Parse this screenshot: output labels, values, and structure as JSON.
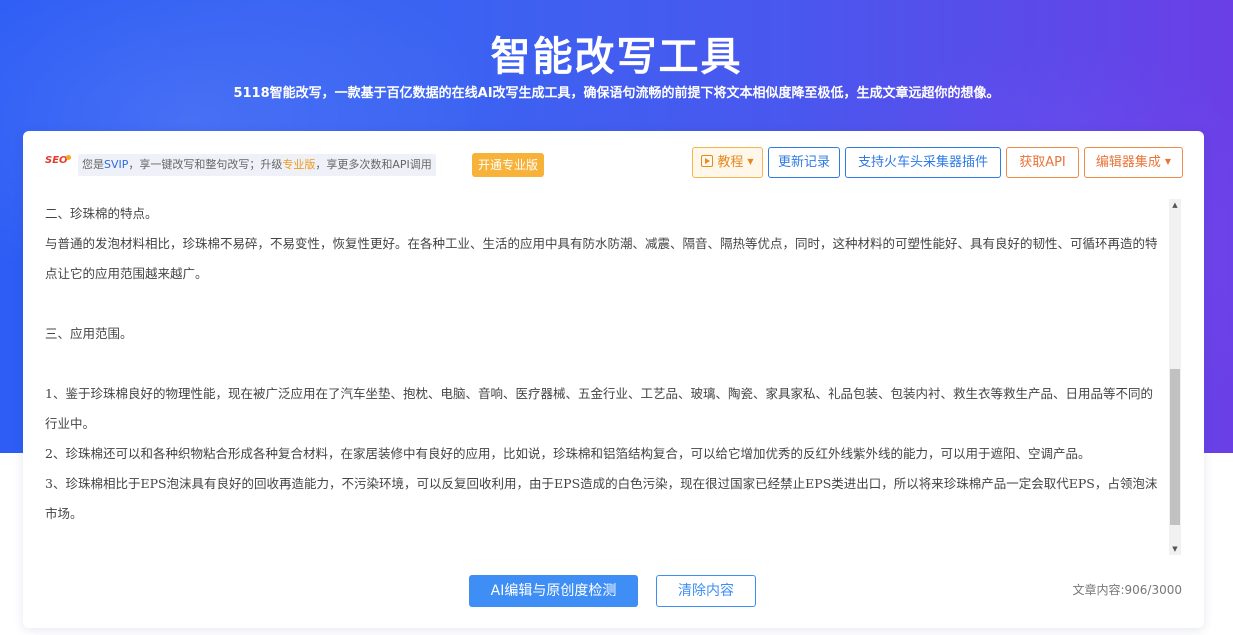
{
  "header": {
    "title": "智能改写工具",
    "subtitle": "5118智能改写，一款基于百亿数据的在线AI改写生成工具，确保语句流畅的前提下将文本相似度降至极低，生成文章远超你的想像。"
  },
  "notice": {
    "logo_text": "SEO",
    "part1": "您是",
    "svip": "SVIP",
    "part2": "，享一键改写和整句改写；升级",
    "pro": "专业版",
    "part3": "，享更多次数和API调用",
    "open_pro_label": "开通专业版"
  },
  "toolbar": {
    "tutorial_label": "教程",
    "history_label": "更新记录",
    "plugin_label": "支持火车头采集器插件",
    "api_label": "获取API",
    "editor_integration_label": "编辑器集成"
  },
  "editor": {
    "paragraphs": [
      "二、珍珠棉的特点。",
      "与普通的发泡材料相比，珍珠棉不易碎，不易变性，恢复性更好。在各种工业、生活的应用中具有防水防潮、减震、隔音、隔热等优点，同时，这种材料的可塑性能好、具有良好的韧性、可循环再造的特点让它的应用范围越来越广。",
      "",
      "三、应用范围。",
      "",
      "1、鉴于珍珠棉良好的物理性能，现在被广泛应用在了汽车坐垫、抱枕、电脑、音响、医疗器械、五金行业、工艺品、玻璃、陶瓷、家具家私、礼品包装、包装内衬、救生衣等救生产品、日用品等不同的行业中。",
      "2、珍珠棉还可以和各种织物粘合形成各种复合材料，在家居装修中有良好的应用，比如说，珍珠棉和铝箔结构复合，可以给它增加优秀的反红外线紫外线的能力，可以用于遮阳、空调产品。",
      "3、珍珠棉相比于EPS泡沫具有良好的回收再造能力，不污染环境，可以反复回收利用，由于EPS造成的白色污染，现在很过国家已经禁止EPS类进出口，所以将来珍珠棉产品一定会取代EPS，占领泡沫市场。"
    ]
  },
  "actions": {
    "primary_label": "AI编辑与原创度检测",
    "clear_label": "清除内容",
    "counter": "文章内容:906/3000"
  },
  "colors": {
    "accent_blue": "#3f8ef5",
    "orange": "#e9743a",
    "hero_start": "#2d5df5",
    "hero_end": "#6a3fe6"
  }
}
